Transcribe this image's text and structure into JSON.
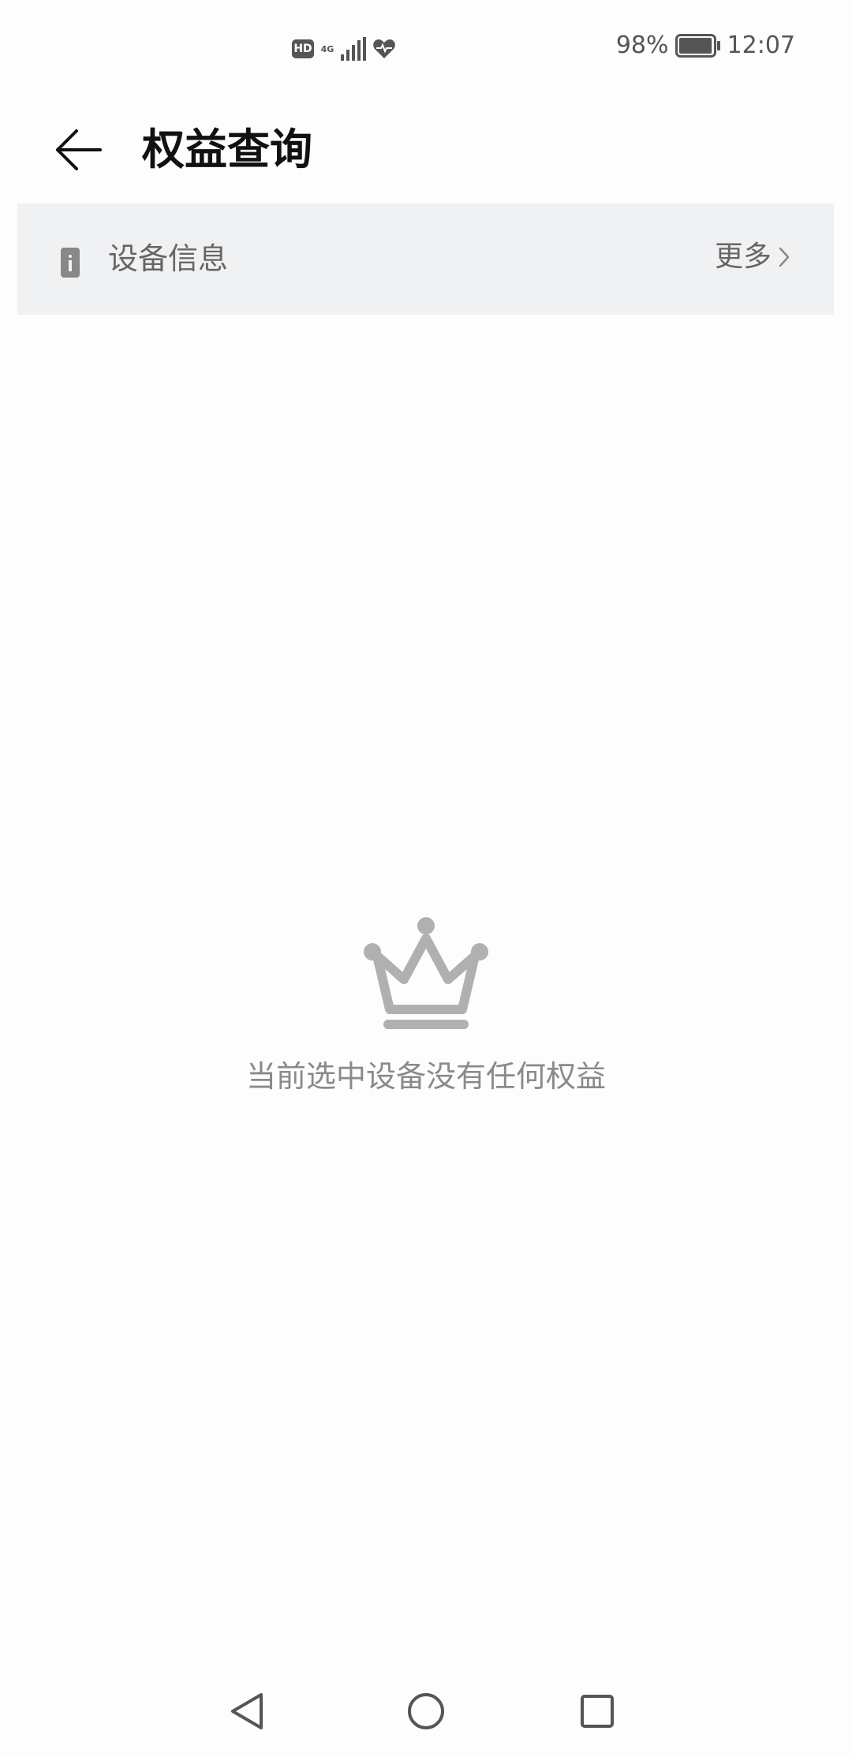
{
  "status_bar": {
    "hd_badge": "HD",
    "network_type": "4G",
    "battery_percent": "98%",
    "battery_level": 0.98,
    "time": "12:07",
    "icons": [
      "hd-icon",
      "signal-icon",
      "health-heart-icon",
      "battery-icon"
    ]
  },
  "header": {
    "title": "权益查询",
    "back_icon": "arrow-left-icon"
  },
  "device_info": {
    "label": "设备信息",
    "more_label": "更多",
    "icon": "device-info-icon",
    "more_icon": "chevron-right-icon"
  },
  "empty_state": {
    "icon": "crown-icon",
    "message": "当前选中设备没有任何权益"
  },
  "nav_bar": {
    "buttons": [
      "back-triangle-icon",
      "home-circle-icon",
      "recents-square-icon"
    ]
  },
  "colors": {
    "background": "#fdfdfd",
    "card_background": "#f0f1f3",
    "muted_text": "#8a8a8a",
    "icon_gray": "#b0b0b0"
  }
}
